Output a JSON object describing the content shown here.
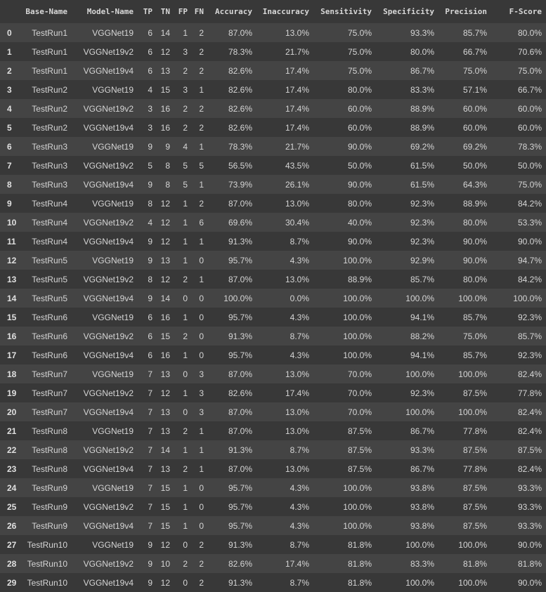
{
  "table": {
    "columns": [
      "",
      "Base-Name",
      "Model-Name",
      "TP",
      "TN",
      "FP",
      "FN",
      "Accuracy",
      "Inaccuracy",
      "Sensitivity",
      "Specificity",
      "Precision",
      "F-Score"
    ],
    "rows": [
      [
        "0",
        "TestRun1",
        "VGGNet19",
        "6",
        "14",
        "1",
        "2",
        "87.0%",
        "13.0%",
        "75.0%",
        "93.3%",
        "85.7%",
        "80.0%"
      ],
      [
        "1",
        "TestRun1",
        "VGGNet19v2",
        "6",
        "12",
        "3",
        "2",
        "78.3%",
        "21.7%",
        "75.0%",
        "80.0%",
        "66.7%",
        "70.6%"
      ],
      [
        "2",
        "TestRun1",
        "VGGNet19v4",
        "6",
        "13",
        "2",
        "2",
        "82.6%",
        "17.4%",
        "75.0%",
        "86.7%",
        "75.0%",
        "75.0%"
      ],
      [
        "3",
        "TestRun2",
        "VGGNet19",
        "4",
        "15",
        "3",
        "1",
        "82.6%",
        "17.4%",
        "80.0%",
        "83.3%",
        "57.1%",
        "66.7%"
      ],
      [
        "4",
        "TestRun2",
        "VGGNet19v2",
        "3",
        "16",
        "2",
        "2",
        "82.6%",
        "17.4%",
        "60.0%",
        "88.9%",
        "60.0%",
        "60.0%"
      ],
      [
        "5",
        "TestRun2",
        "VGGNet19v4",
        "3",
        "16",
        "2",
        "2",
        "82.6%",
        "17.4%",
        "60.0%",
        "88.9%",
        "60.0%",
        "60.0%"
      ],
      [
        "6",
        "TestRun3",
        "VGGNet19",
        "9",
        "9",
        "4",
        "1",
        "78.3%",
        "21.7%",
        "90.0%",
        "69.2%",
        "69.2%",
        "78.3%"
      ],
      [
        "7",
        "TestRun3",
        "VGGNet19v2",
        "5",
        "8",
        "5",
        "5",
        "56.5%",
        "43.5%",
        "50.0%",
        "61.5%",
        "50.0%",
        "50.0%"
      ],
      [
        "8",
        "TestRun3",
        "VGGNet19v4",
        "9",
        "8",
        "5",
        "1",
        "73.9%",
        "26.1%",
        "90.0%",
        "61.5%",
        "64.3%",
        "75.0%"
      ],
      [
        "9",
        "TestRun4",
        "VGGNet19",
        "8",
        "12",
        "1",
        "2",
        "87.0%",
        "13.0%",
        "80.0%",
        "92.3%",
        "88.9%",
        "84.2%"
      ],
      [
        "10",
        "TestRun4",
        "VGGNet19v2",
        "4",
        "12",
        "1",
        "6",
        "69.6%",
        "30.4%",
        "40.0%",
        "92.3%",
        "80.0%",
        "53.3%"
      ],
      [
        "11",
        "TestRun4",
        "VGGNet19v4",
        "9",
        "12",
        "1",
        "1",
        "91.3%",
        "8.7%",
        "90.0%",
        "92.3%",
        "90.0%",
        "90.0%"
      ],
      [
        "12",
        "TestRun5",
        "VGGNet19",
        "9",
        "13",
        "1",
        "0",
        "95.7%",
        "4.3%",
        "100.0%",
        "92.9%",
        "90.0%",
        "94.7%"
      ],
      [
        "13",
        "TestRun5",
        "VGGNet19v2",
        "8",
        "12",
        "2",
        "1",
        "87.0%",
        "13.0%",
        "88.9%",
        "85.7%",
        "80.0%",
        "84.2%"
      ],
      [
        "14",
        "TestRun5",
        "VGGNet19v4",
        "9",
        "14",
        "0",
        "0",
        "100.0%",
        "0.0%",
        "100.0%",
        "100.0%",
        "100.0%",
        "100.0%"
      ],
      [
        "15",
        "TestRun6",
        "VGGNet19",
        "6",
        "16",
        "1",
        "0",
        "95.7%",
        "4.3%",
        "100.0%",
        "94.1%",
        "85.7%",
        "92.3%"
      ],
      [
        "16",
        "TestRun6",
        "VGGNet19v2",
        "6",
        "15",
        "2",
        "0",
        "91.3%",
        "8.7%",
        "100.0%",
        "88.2%",
        "75.0%",
        "85.7%"
      ],
      [
        "17",
        "TestRun6",
        "VGGNet19v4",
        "6",
        "16",
        "1",
        "0",
        "95.7%",
        "4.3%",
        "100.0%",
        "94.1%",
        "85.7%",
        "92.3%"
      ],
      [
        "18",
        "TestRun7",
        "VGGNet19",
        "7",
        "13",
        "0",
        "3",
        "87.0%",
        "13.0%",
        "70.0%",
        "100.0%",
        "100.0%",
        "82.4%"
      ],
      [
        "19",
        "TestRun7",
        "VGGNet19v2",
        "7",
        "12",
        "1",
        "3",
        "82.6%",
        "17.4%",
        "70.0%",
        "92.3%",
        "87.5%",
        "77.8%"
      ],
      [
        "20",
        "TestRun7",
        "VGGNet19v4",
        "7",
        "13",
        "0",
        "3",
        "87.0%",
        "13.0%",
        "70.0%",
        "100.0%",
        "100.0%",
        "82.4%"
      ],
      [
        "21",
        "TestRun8",
        "VGGNet19",
        "7",
        "13",
        "2",
        "1",
        "87.0%",
        "13.0%",
        "87.5%",
        "86.7%",
        "77.8%",
        "82.4%"
      ],
      [
        "22",
        "TestRun8",
        "VGGNet19v2",
        "7",
        "14",
        "1",
        "1",
        "91.3%",
        "8.7%",
        "87.5%",
        "93.3%",
        "87.5%",
        "87.5%"
      ],
      [
        "23",
        "TestRun8",
        "VGGNet19v4",
        "7",
        "13",
        "2",
        "1",
        "87.0%",
        "13.0%",
        "87.5%",
        "86.7%",
        "77.8%",
        "82.4%"
      ],
      [
        "24",
        "TestRun9",
        "VGGNet19",
        "7",
        "15",
        "1",
        "0",
        "95.7%",
        "4.3%",
        "100.0%",
        "93.8%",
        "87.5%",
        "93.3%"
      ],
      [
        "25",
        "TestRun9",
        "VGGNet19v2",
        "7",
        "15",
        "1",
        "0",
        "95.7%",
        "4.3%",
        "100.0%",
        "93.8%",
        "87.5%",
        "93.3%"
      ],
      [
        "26",
        "TestRun9",
        "VGGNet19v4",
        "7",
        "15",
        "1",
        "0",
        "95.7%",
        "4.3%",
        "100.0%",
        "93.8%",
        "87.5%",
        "93.3%"
      ],
      [
        "27",
        "TestRun10",
        "VGGNet19",
        "9",
        "12",
        "0",
        "2",
        "91.3%",
        "8.7%",
        "81.8%",
        "100.0%",
        "100.0%",
        "90.0%"
      ],
      [
        "28",
        "TestRun10",
        "VGGNet19v2",
        "9",
        "10",
        "2",
        "2",
        "82.6%",
        "17.4%",
        "81.8%",
        "83.3%",
        "81.8%",
        "81.8%"
      ],
      [
        "29",
        "TestRun10",
        "VGGNet19v4",
        "9",
        "12",
        "0",
        "2",
        "91.3%",
        "8.7%",
        "81.8%",
        "100.0%",
        "100.0%",
        "90.0%"
      ]
    ]
  }
}
